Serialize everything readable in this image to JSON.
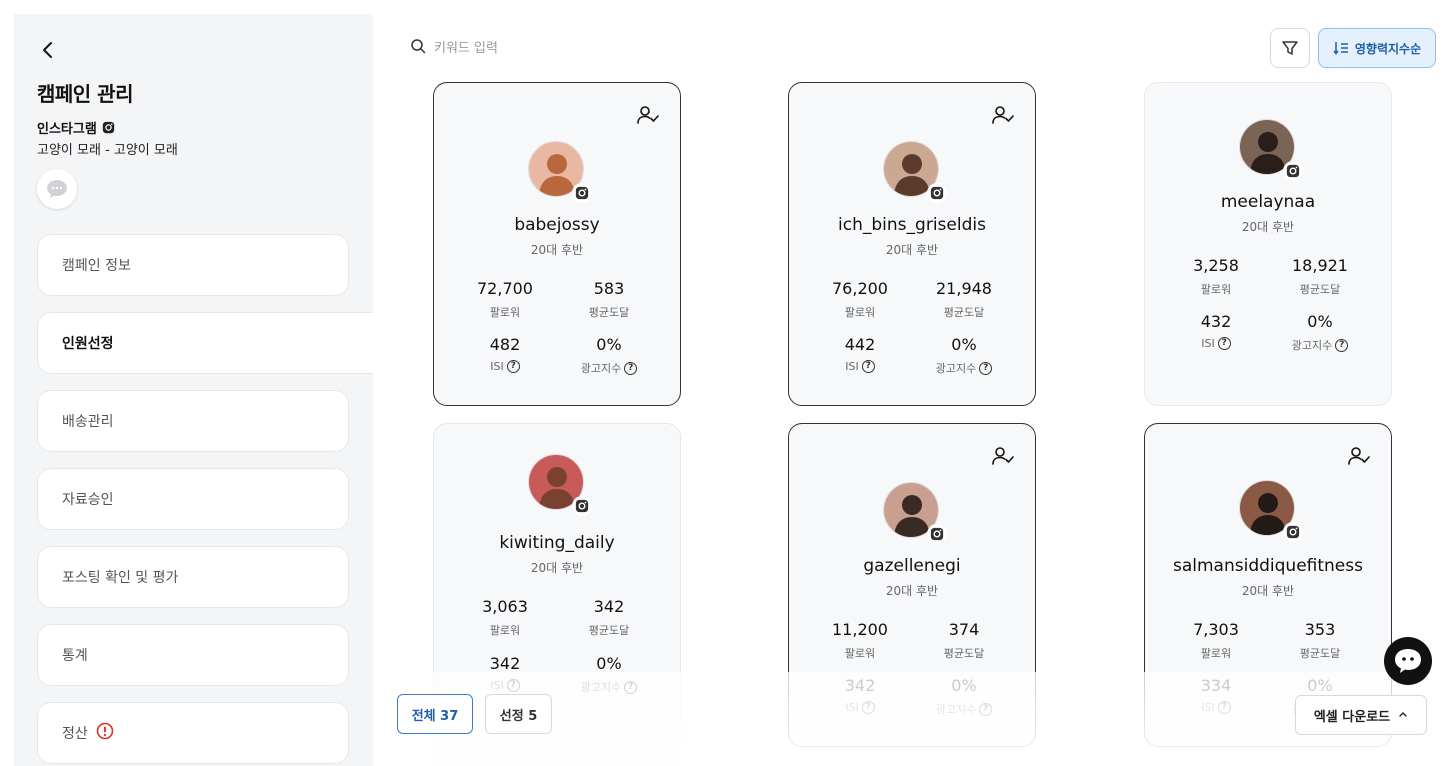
{
  "sidebar": {
    "title": "캠페인 관리",
    "platform": "인스타그램",
    "campaign_name": "고양이 모래 - 고양이 모래",
    "nav": [
      {
        "label": "캠페인 정보",
        "active": false,
        "alert": false
      },
      {
        "label": "인원선정",
        "active": true,
        "alert": false
      },
      {
        "label": "배송관리",
        "active": false,
        "alert": false
      },
      {
        "label": "자료승인",
        "active": false,
        "alert": false
      },
      {
        "label": "포스팅 확인 및 평가",
        "active": false,
        "alert": false
      },
      {
        "label": "통계",
        "active": false,
        "alert": false
      },
      {
        "label": "정산",
        "active": false,
        "alert": true
      }
    ]
  },
  "toolbar": {
    "search_placeholder": "키워드 입력",
    "sort_label": "영향력지수순"
  },
  "stat_labels": {
    "followers": "팔로워",
    "avg_reach": "평균도달",
    "isi": "ISI",
    "ad_index": "광고지수"
  },
  "cards": [
    {
      "handle": "babejossy",
      "age": "20대 후반",
      "followers": "72,700",
      "avg_reach": "583",
      "isi": "482",
      "ad_index": "0%",
      "selected": true
    },
    {
      "handle": "ich_bins_griseldis",
      "age": "20대 후반",
      "followers": "76,200",
      "avg_reach": "21,948",
      "isi": "442",
      "ad_index": "0%",
      "selected": true
    },
    {
      "handle": "meelaynaa",
      "age": "20대 후반",
      "followers": "3,258",
      "avg_reach": "18,921",
      "isi": "432",
      "ad_index": "0%",
      "selected": false
    },
    {
      "handle": "kiwiting_daily",
      "age": "20대 후반",
      "followers": "3,063",
      "avg_reach": "342",
      "isi": "342",
      "ad_index": "0%",
      "selected": false
    },
    {
      "handle": "gazellenegi",
      "age": "20대 후반",
      "followers": "11,200",
      "avg_reach": "374",
      "isi": "342",
      "ad_index": "0%",
      "selected": true
    },
    {
      "handle": "salmansiddiquefitness",
      "age": "20대 후반",
      "followers": "7,303",
      "avg_reach": "353",
      "isi": "334",
      "ad_index": "0%",
      "selected": true
    }
  ],
  "footer": {
    "all_label": "전체 37",
    "selected_label": "선정 5",
    "excel_label": "엑셀 다운로드"
  },
  "colors": {
    "accent": "#1f5fa8",
    "sidebar_bg": "#f4f5f7",
    "card_bg": "#f7f8fa",
    "alert": "#d93025"
  }
}
